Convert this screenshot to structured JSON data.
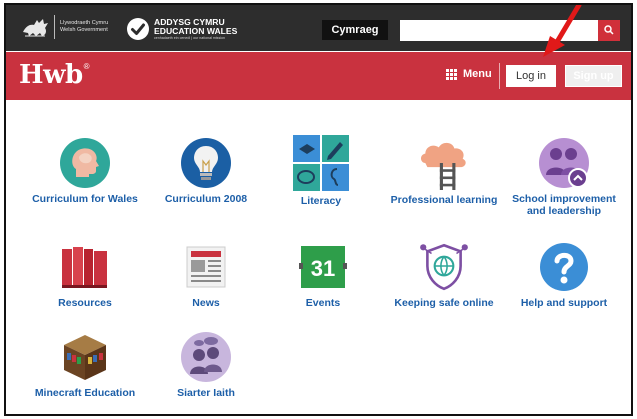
{
  "topbar": {
    "gov_logo_line1": "Llywodraeth Cymru",
    "gov_logo_line2": "Welsh Government",
    "edu_logo_line1": "ADDYSG CYMRU",
    "edu_logo_line2": "EDUCATION WALES",
    "edu_logo_tagline": "cenhadaeth ein cenedl | our national mission",
    "language_button": "Cymraeg",
    "search_placeholder": "",
    "search_icon": "search-icon"
  },
  "header": {
    "brand": "Hwb",
    "brand_mark": "®",
    "menu_label": "Menu",
    "login_label": "Log in",
    "signup_label": "Sign up",
    "accent_color": "#c9323f"
  },
  "tiles": [
    {
      "label": "Curriculum for Wales",
      "icon": "head-profile-icon"
    },
    {
      "label": "Curriculum 2008",
      "icon": "lightbulb-icon"
    },
    {
      "label": "Literacy",
      "icon": "literacy-icon"
    },
    {
      "label": "Professional learning",
      "icon": "cloud-ladder-icon"
    },
    {
      "label": "School improvement and leadership",
      "icon": "people-group-icon"
    },
    {
      "label": "Resources",
      "icon": "books-icon"
    },
    {
      "label": "News",
      "icon": "newspaper-icon"
    },
    {
      "label": "Events",
      "icon": "calendar-icon"
    },
    {
      "label": "Keeping safe online",
      "icon": "safe-online-icon"
    },
    {
      "label": "Help and support",
      "icon": "help-icon"
    },
    {
      "label": "Minecraft Education",
      "icon": "minecraft-bookshelf-icon"
    },
    {
      "label": "Siarter Iaith",
      "icon": "siarter-iaith-icon"
    }
  ]
}
